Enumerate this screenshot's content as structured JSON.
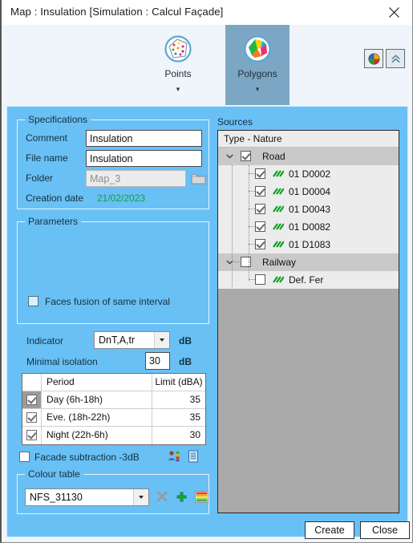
{
  "window": {
    "title": "Map : Insulation [Simulation : Calcul Façade]",
    "close_icon": "close-icon"
  },
  "ribbon": {
    "tools": [
      {
        "label": "Points",
        "icon": "points-map-icon",
        "selected": false
      },
      {
        "label": "Polygons",
        "icon": "polygons-map-icon",
        "selected": true
      }
    ],
    "right_buttons": [
      {
        "icon": "colour-palette-icon",
        "name": "colour-palette-button"
      },
      {
        "icon": "double-chevron-up-icon",
        "name": "collapse-ribbon-button"
      }
    ]
  },
  "specifications": {
    "title": "Specifications",
    "comment_label": "Comment",
    "comment_value": "Insulation",
    "filename_label": "File name",
    "filename_value": "Insulation",
    "folder_label": "Folder",
    "folder_value": "Map_3",
    "folder_browse_icon": "folder-icon",
    "creation_label": "Creation date",
    "creation_value": "21/02/2023",
    "creation_color": "#0fa23c"
  },
  "parameters": {
    "title": "Parameters",
    "faces_fusion_label": "Faces fusion of same interval",
    "faces_fusion_checked": false,
    "indicator_label": "Indicator",
    "indicator_value": "DnT,A,tr",
    "indicator_unit": "dB",
    "minimal_isolation_label": "Minimal isolation",
    "minimal_isolation_value": "30",
    "minimal_isolation_unit": "dB",
    "table": {
      "columns": [
        "",
        "Period",
        "Limit (dBA)"
      ],
      "rows": [
        {
          "checked": true,
          "selected": true,
          "period": "Day (6h-18h)",
          "limit": "35"
        },
        {
          "checked": true,
          "selected": false,
          "period": "Eve. (18h-22h)",
          "limit": "35"
        },
        {
          "checked": true,
          "selected": false,
          "period": "Night (22h-6h)",
          "limit": "30"
        }
      ]
    },
    "facade_subtraction_label": "Facade subtraction -3dB",
    "facade_subtraction_checked": false,
    "mini_icons": [
      {
        "name": "receiver-legend-icon"
      },
      {
        "name": "report-document-icon"
      }
    ]
  },
  "colour_table": {
    "title": "Colour table",
    "selected": "NFS_31130",
    "actions": [
      {
        "name": "delete-colour-table-button",
        "icon": "cross-icon",
        "color": "#9a9a9a"
      },
      {
        "name": "add-colour-table-button",
        "icon": "plus-icon",
        "color": "#14a83c"
      },
      {
        "name": "edit-colour-table-button",
        "icon": "colour-bands-icon",
        "color": "#d94f2a"
      }
    ]
  },
  "sources": {
    "title": "Sources",
    "column_header": "Type - Nature",
    "groups": [
      {
        "label": "Road",
        "checked": true,
        "expanded": true,
        "children": [
          {
            "label": "01 D0002",
            "checked": true,
            "icon": "road-source-icon"
          },
          {
            "label": "01 D0004",
            "checked": true,
            "icon": "road-source-icon"
          },
          {
            "label": "01 D0043",
            "checked": true,
            "icon": "road-source-icon"
          },
          {
            "label": "01 D0082",
            "checked": true,
            "icon": "road-source-icon"
          },
          {
            "label": "01 D1083",
            "checked": true,
            "icon": "road-source-icon"
          }
        ]
      },
      {
        "label": "Railway",
        "checked": false,
        "expanded": true,
        "children": [
          {
            "label": "Def. Fer",
            "checked": false,
            "icon": "railway-source-icon"
          }
        ]
      }
    ]
  },
  "footer": {
    "create_label": "Create",
    "close_label": "Close"
  },
  "colors": {
    "panel_blue": "#69c0f5",
    "ribbon_bg": "#f0f5fb",
    "selected_tool": "#7ba7c4",
    "tree_empty": "#aaaaaa",
    "accent_green": "#0fa23c"
  }
}
